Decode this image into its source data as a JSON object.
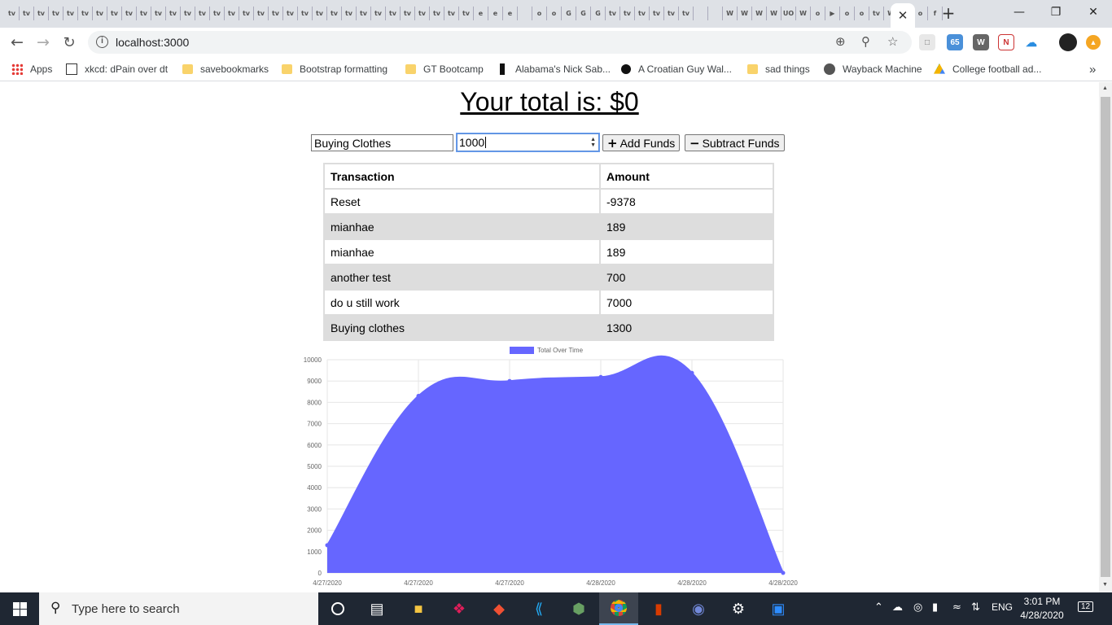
{
  "browser": {
    "tab_favicons": [
      "tv",
      "tv",
      "tv",
      "tv",
      "tv",
      "tv",
      "tv",
      "tv",
      "tv",
      "tv",
      "tv",
      "tv",
      "tv",
      "tv",
      "tv",
      "tv",
      "tv",
      "tv",
      "tv",
      "tv",
      "tv",
      "tv",
      "tv",
      "tv",
      "tv",
      "tv",
      "tv",
      "tv",
      "tv",
      "tv",
      "tv",
      "tv",
      "e",
      "e",
      "e",
      "",
      "o",
      "o",
      "G",
      "G",
      "G",
      "tv",
      "tv",
      "tv",
      "tv",
      "tv",
      "tv",
      "",
      "",
      "W",
      "W",
      "W",
      "W",
      "UO",
      "W",
      "o",
      "▶",
      "o",
      "o",
      "tv",
      "W",
      "o",
      "o",
      "f"
    ],
    "active_tab_close": "✕",
    "new_tab": "+",
    "window_controls": {
      "minimize": "—",
      "restore": "❐",
      "close": "✕"
    },
    "url": "localhost:3000",
    "extension_badge": "65",
    "bookmarks": [
      {
        "label": "Apps",
        "icon": "apps-grid-icon"
      },
      {
        "label": "xkcd: dPain over dt",
        "icon": "xkcd-icon"
      },
      {
        "label": "savebookmarks",
        "icon": "folder-icon"
      },
      {
        "label": "Bootstrap formatting",
        "icon": "folder-icon"
      },
      {
        "label": "GT Bootcamp",
        "icon": "folder-icon"
      },
      {
        "label": "Alabama's Nick Sab...",
        "icon": "site-icon"
      },
      {
        "label": "A Croatian Guy Wal...",
        "icon": "site-icon"
      },
      {
        "label": "sad things",
        "icon": "folder-icon"
      },
      {
        "label": "Wayback Machine",
        "icon": "wayback-icon"
      },
      {
        "label": "College football ad...",
        "icon": "drive-icon"
      }
    ],
    "bookmarks_more": "»"
  },
  "page": {
    "total_heading": "Your total is: $0",
    "name_input_value": "Buying Clothes",
    "amount_input_value": "1000",
    "add_button_icon": "+",
    "add_button_label": "Add Funds",
    "subtract_button_icon": "−",
    "subtract_button_label": "Subtract Funds",
    "table": {
      "headers": [
        "Transaction",
        "Amount"
      ],
      "rows": [
        [
          "Reset",
          "-9378"
        ],
        [
          "mianhae",
          "189"
        ],
        [
          "mianhae",
          "189"
        ],
        [
          "another test",
          "700"
        ],
        [
          "do u still work",
          "7000"
        ],
        [
          "Buying clothes",
          "1300"
        ]
      ]
    }
  },
  "chart_data": {
    "type": "area",
    "legend": "Total Over Time",
    "legend_position": "top",
    "color": "#6666ff",
    "x": [
      "4/27/2020",
      "4/27/2020",
      "4/27/2020",
      "4/28/2020",
      "4/28/2020",
      "4/28/2020"
    ],
    "series": [
      {
        "name": "Total Over Time",
        "values": [
          1300,
          8300,
          9000,
          9189,
          9378,
          0
        ]
      }
    ],
    "ylim": [
      0,
      10000
    ],
    "y_ticks": [
      "0",
      "1000",
      "2000",
      "3000",
      "4000",
      "5000",
      "6000",
      "7000",
      "8000",
      "9000",
      "10000"
    ],
    "grid": true
  },
  "taskbar": {
    "search_placeholder": "Type here to search",
    "language": "ENG",
    "time": "3:01 PM",
    "date": "4/28/2020",
    "notifications": "12"
  }
}
